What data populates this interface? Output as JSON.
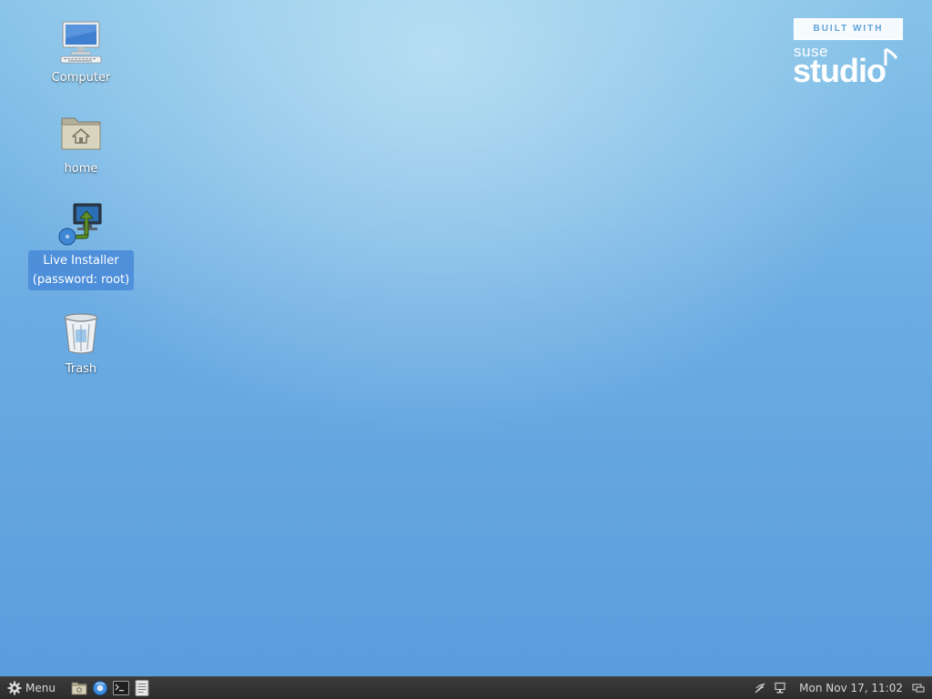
{
  "desktop": {
    "icons": [
      {
        "label": "Computer",
        "icon": "computer-icon"
      },
      {
        "label": "home",
        "icon": "home-folder-icon"
      },
      {
        "label": "Live Installer\n(password: root)",
        "icon": "installer-icon",
        "selected": true
      },
      {
        "label": "Trash",
        "icon": "trash-icon"
      }
    ],
    "brand": {
      "built_with": "BUILT WITH",
      "suse": "suse",
      "studio": "studio"
    }
  },
  "taskbar": {
    "menu_label": "Menu",
    "menu_icon": "gear-icon",
    "launchers": [
      {
        "icon": "file-manager-icon"
      },
      {
        "icon": "web-browser-icon"
      },
      {
        "icon": "terminal-icon"
      },
      {
        "icon": "text-editor-icon"
      }
    ],
    "tray": {
      "icons": [
        "network-icon",
        "display-icon"
      ],
      "clock": "Mon Nov 17, 11:02",
      "show_desktop_icon": "show-desktop-icon"
    }
  },
  "colors": {
    "desktop_top": "#86c3e8",
    "desktop_bottom": "#5a9ddd",
    "taskbar": "#2f2f2f",
    "selection": "#488ad8"
  }
}
